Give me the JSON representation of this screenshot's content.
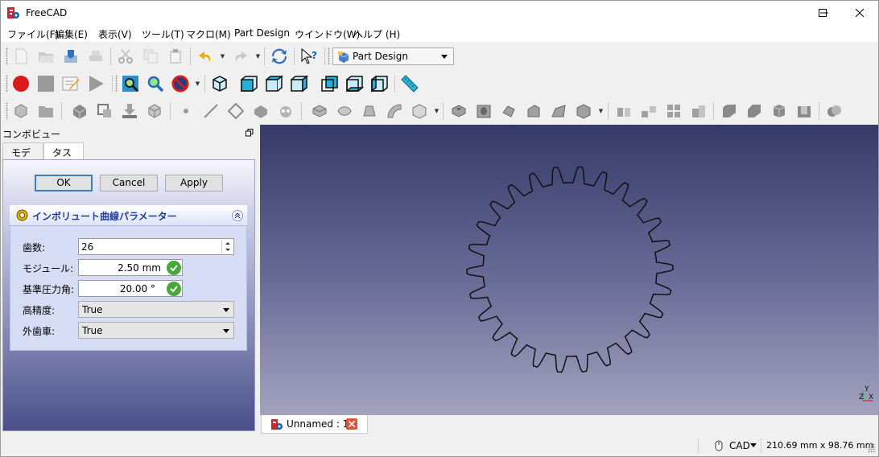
{
  "window": {
    "title": "FreeCAD"
  },
  "menu": [
    {
      "label": "ファイル(F)"
    },
    {
      "label": "編集(E)"
    },
    {
      "label": "表示(V)"
    },
    {
      "label": "ツール(T)"
    },
    {
      "label": "マクロ(M)"
    },
    {
      "label": "Part Design"
    },
    {
      "label": "ウインドウ(W)"
    },
    {
      "label": "ヘルプ (H)"
    }
  ],
  "workbench": {
    "selected": "Part Design"
  },
  "combo": {
    "title": "コンボビュー",
    "tabs": [
      {
        "label": "モデル"
      },
      {
        "label": "タスク"
      }
    ],
    "buttons": {
      "ok": "OK",
      "cancel": "Cancel",
      "apply": "Apply"
    }
  },
  "params": {
    "title": "インボリュート曲線パラメーター",
    "teeth": {
      "label": "歯数:",
      "value": "26"
    },
    "module": {
      "label": "モジュール:",
      "value": "2.50 mm"
    },
    "pressure_angle": {
      "label": "基準圧力角:",
      "value": "20.00 °"
    },
    "high_precision": {
      "label": "高精度:",
      "value": "True"
    },
    "external_gear": {
      "label": "外歯車:",
      "value": "True"
    }
  },
  "gear": {
    "teeth": 26
  },
  "axis": {
    "y": "Y",
    "z": "Z",
    "x": "X"
  },
  "doc_tab": {
    "label": "Unnamed : 1*"
  },
  "status": {
    "nav_style": "CAD",
    "dimensions": "210.69 mm x 98.76 mm"
  },
  "colors": {
    "background_top": "#363a68",
    "background_bottom": "#a3a3be",
    "accept": "#47a738",
    "close": "#e0533a"
  }
}
